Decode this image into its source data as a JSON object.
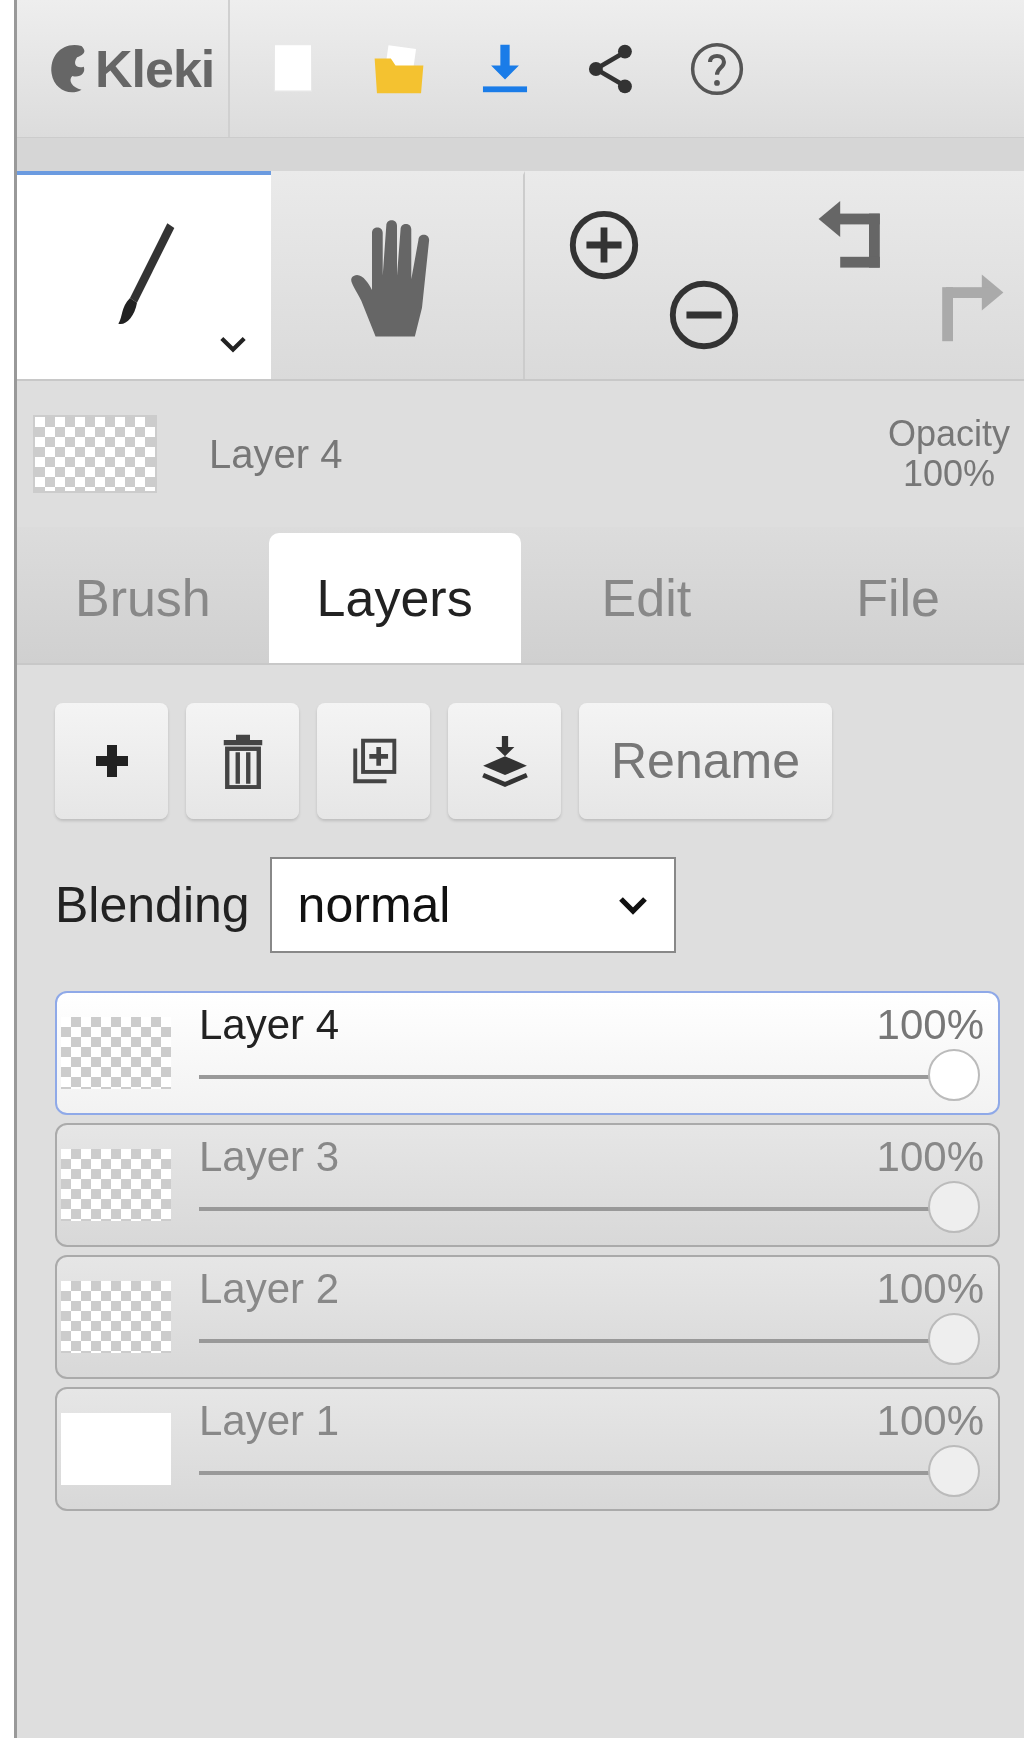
{
  "logo": {
    "text": "Kleki"
  },
  "tools": [
    {
      "kind": "brush",
      "selected": true
    },
    {
      "kind": "hand",
      "selected": false
    }
  ],
  "history": {
    "undo_disabled": false,
    "redo_disabled": true
  },
  "current_layer": {
    "name": "Layer 4",
    "opacity_label": "Opacity",
    "opacity": "100%"
  },
  "tabs": [
    {
      "label": "Brush",
      "selected": false
    },
    {
      "label": "Layers",
      "selected": true
    },
    {
      "label": "Edit",
      "selected": false
    },
    {
      "label": "File",
      "selected": false
    }
  ],
  "layer_actions": {
    "rename": "Rename"
  },
  "blending": {
    "label": "Blending",
    "value": "normal"
  },
  "layers": [
    {
      "name": "Layer 4",
      "opacity": "100%",
      "level": 1,
      "selected": true,
      "kind": "transparent"
    },
    {
      "name": "Layer 3",
      "opacity": "100%",
      "level": 1,
      "selected": false,
      "kind": "transparent"
    },
    {
      "name": "Layer 2",
      "opacity": "100%",
      "level": 1,
      "selected": false,
      "kind": "transparent"
    },
    {
      "name": "Layer 1",
      "opacity": "100%",
      "level": 1,
      "selected": false,
      "kind": "white"
    }
  ]
}
